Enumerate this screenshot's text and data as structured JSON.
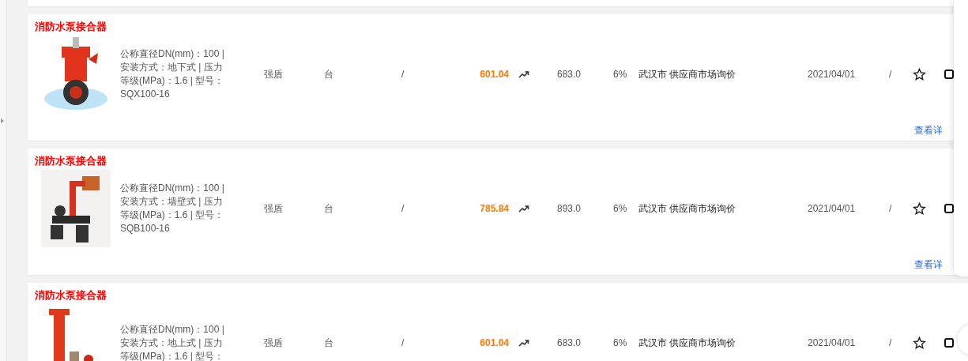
{
  "products": [
    {
      "title": "消防水泵接合器",
      "specs": "公称直径DN(mm)：100 | 安装方式：地下式 | 压力等级(MPa)：1.6 | 型号：SQX100-16",
      "brand": "强盾",
      "unit": "台",
      "column_3": "/",
      "price": "601.04",
      "market_price": "683.0",
      "tax": "6%",
      "source": "武汉市 供应商市场询价",
      "date": "2021/04/01",
      "column_9": "/",
      "link": "查看详"
    },
    {
      "title": "消防水泵接合器",
      "specs": "公称直径DN(mm)：100 | 安装方式：墙壁式 | 压力等级(MPa)：1.6 | 型号：SQB100-16",
      "brand": "强盾",
      "unit": "台",
      "column_3": "/",
      "price": "785.84",
      "market_price": "893.0",
      "tax": "6%",
      "source": "武汉市 供应商市场询价",
      "date": "2021/04/01",
      "column_9": "/",
      "link": "查看详"
    },
    {
      "title": "消防水泵接合器",
      "specs": "公称直径DN(mm)：100 | 安装方式：地上式 | 压力等级(MPa)：1.6 | 型号：",
      "brand": "强盾",
      "unit": "台",
      "column_3": "/",
      "price": "601.04",
      "market_price": "683.0",
      "tax": "6%",
      "source": "武汉市 供应商市场询价",
      "date": "2021/04/01",
      "column_9": "/"
    }
  ]
}
